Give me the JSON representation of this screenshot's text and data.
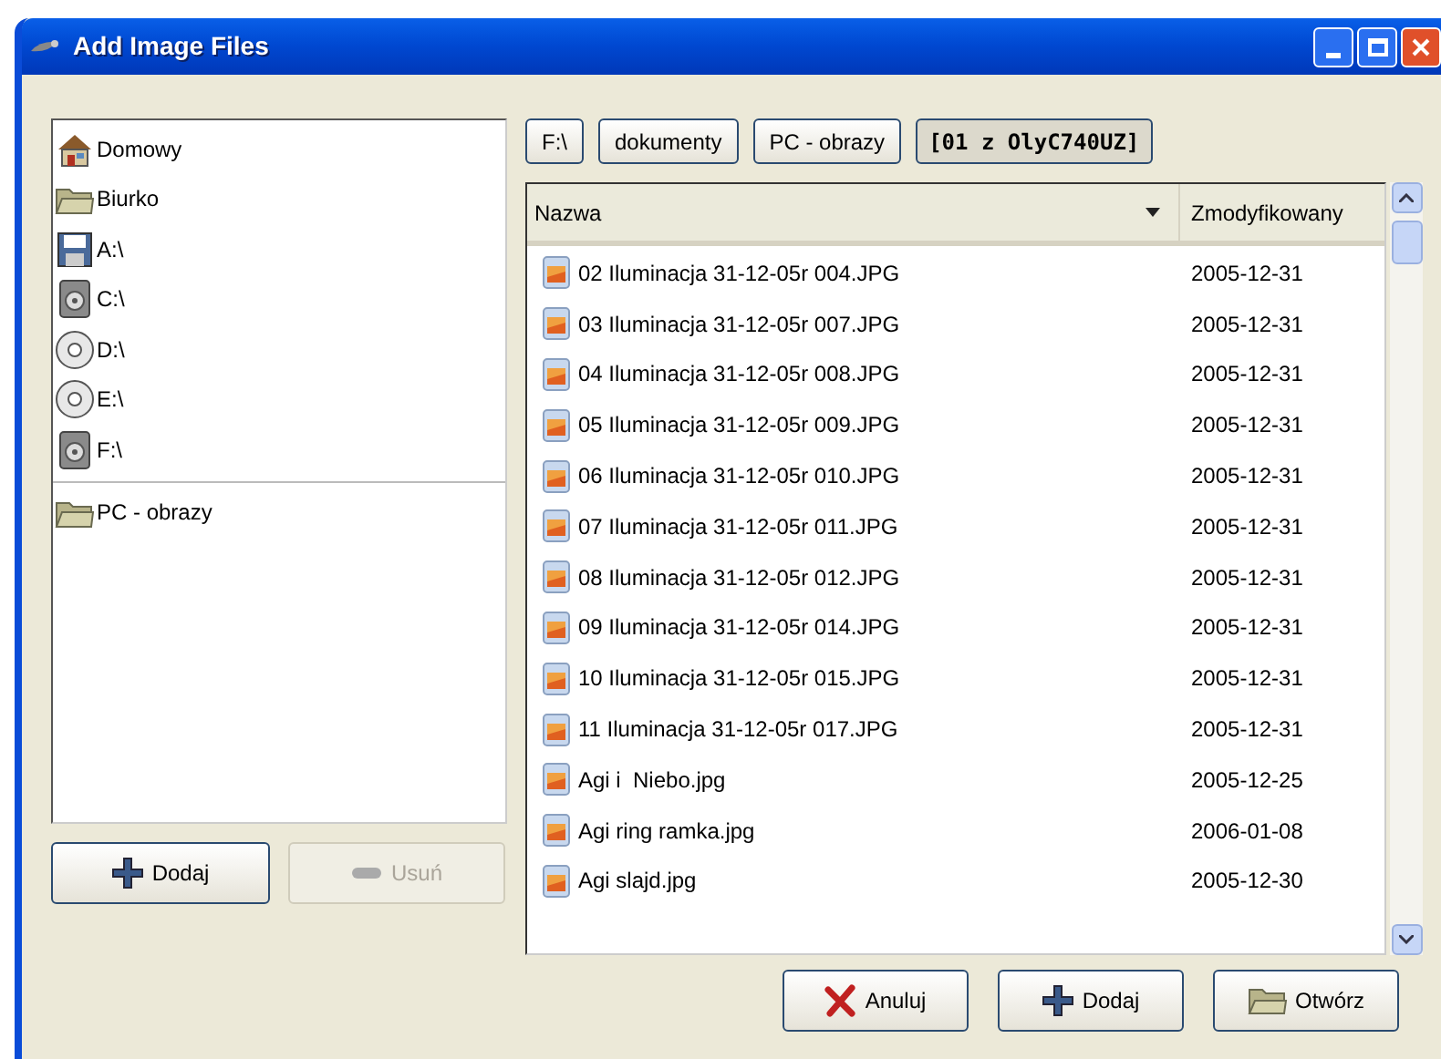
{
  "window": {
    "title": "Add Image Files"
  },
  "places": [
    {
      "kind": "home",
      "label": "Domowy"
    },
    {
      "kind": "folder",
      "label": "Biurko"
    },
    {
      "kind": "floppy",
      "label": "A:\\"
    },
    {
      "kind": "harddisk",
      "label": "C:\\"
    },
    {
      "kind": "cd",
      "label": "D:\\"
    },
    {
      "kind": "cd",
      "label": "E:\\"
    },
    {
      "kind": "harddisk",
      "label": "F:\\"
    }
  ],
  "bookmarks": [
    {
      "kind": "folder",
      "label": "PC - obrazy"
    }
  ],
  "places_buttons": [
    {
      "kind": "add",
      "label": "Dodaj",
      "disabled": false
    },
    {
      "kind": "remove",
      "label": "Usuń",
      "disabled": true
    }
  ],
  "path": [
    {
      "label": "F:\\",
      "selected": false
    },
    {
      "label": "dokumenty",
      "selected": false
    },
    {
      "label": "PC - obrazy",
      "selected": false
    },
    {
      "label": "[01 z OlyC740UZ]",
      "selected": true
    }
  ],
  "table": {
    "columns": [
      {
        "label": "Nazwa",
        "sorted": true
      },
      {
        "label": "Zmodyfikowany",
        "sorted": false
      }
    ],
    "rows": [
      {
        "name": "02 Iluminacja 31-12-05r 004.JPG",
        "date": "2005-12-31"
      },
      {
        "name": "03 Iluminacja 31-12-05r 007.JPG",
        "date": "2005-12-31"
      },
      {
        "name": "04 Iluminacja 31-12-05r 008.JPG",
        "date": "2005-12-31"
      },
      {
        "name": "05 Iluminacja 31-12-05r 009.JPG",
        "date": "2005-12-31"
      },
      {
        "name": "06 Iluminacja 31-12-05r 010.JPG",
        "date": "2005-12-31"
      },
      {
        "name": "07 Iluminacja 31-12-05r 011.JPG",
        "date": "2005-12-31"
      },
      {
        "name": "08 Iluminacja 31-12-05r 012.JPG",
        "date": "2005-12-31"
      },
      {
        "name": "09 Iluminacja 31-12-05r 014.JPG",
        "date": "2005-12-31"
      },
      {
        "name": "10 Iluminacja 31-12-05r 015.JPG",
        "date": "2005-12-31"
      },
      {
        "name": "11 Iluminacja 31-12-05r 017.JPG",
        "date": "2005-12-31"
      },
      {
        "name": "Agi i  Niebo.jpg",
        "date": "2005-12-25"
      },
      {
        "name": "Agi ring ramka.jpg",
        "date": "2006-01-08"
      },
      {
        "name": "Agi slajd.jpg",
        "date": "2005-12-30"
      }
    ]
  },
  "buttons": [
    {
      "kind": "cancel",
      "label": "Anuluj"
    },
    {
      "kind": "add",
      "label": "Dodaj"
    },
    {
      "kind": "open",
      "label": "Otwórz"
    }
  ]
}
